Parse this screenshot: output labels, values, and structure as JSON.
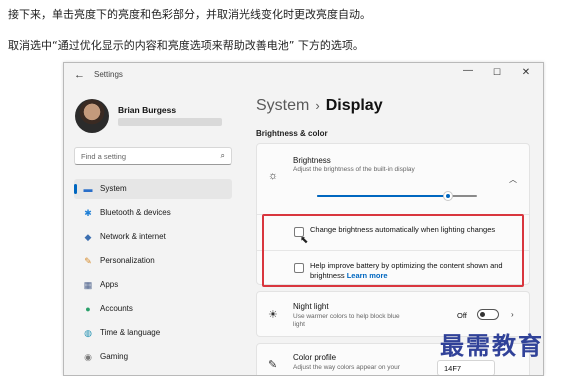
{
  "intro": {
    "line1": "接下来，单击亮度下的亮度和色彩部分，并取消光线变化时更改亮度自动。",
    "line2": "取消选中“通过优化显示的内容和亮度选项来帮助改善电池” 下方的选项。"
  },
  "window": {
    "title": "Settings",
    "controls": {
      "minimize": "—",
      "maximize": "☐",
      "close": "✕"
    }
  },
  "profile": {
    "name": "Brian Burgess"
  },
  "search": {
    "placeholder": "Find a setting"
  },
  "nav": [
    {
      "label": "System",
      "icon": "monitor-icon",
      "active": true
    },
    {
      "label": "Bluetooth & devices",
      "icon": "bluetooth-icon"
    },
    {
      "label": "Network & internet",
      "icon": "wifi-icon"
    },
    {
      "label": "Personalization",
      "icon": "paintbrush-icon"
    },
    {
      "label": "Apps",
      "icon": "apps-icon"
    },
    {
      "label": "Accounts",
      "icon": "person-icon"
    },
    {
      "label": "Time & language",
      "icon": "globe-clock-icon"
    },
    {
      "label": "Gaming",
      "icon": "gamepad-icon"
    }
  ],
  "breadcrumb": {
    "parent": "System",
    "separator": "›",
    "current": "Display"
  },
  "section": {
    "title": "Brightness & color"
  },
  "brightness": {
    "title": "Brightness",
    "subtitle": "Adjust the brightness of the built-in display",
    "level": 0.82,
    "options": [
      {
        "label": "Change brightness automatically when lighting changes",
        "checked": false
      },
      {
        "label": "Help improve battery by optimizing the content shown and brightness",
        "link": "Learn more",
        "checked": false
      }
    ]
  },
  "night_light": {
    "title": "Night light",
    "subtitle": "Use warmer colors to help block blue light",
    "state": "Off"
  },
  "color_profile": {
    "title": "Color profile",
    "subtitle": "Adjust the way colors appear on your",
    "value": "14F7"
  },
  "watermark": "最需教育",
  "colors": {
    "accent": "#0067c0",
    "highlight_box": "#d9363e",
    "watermark": "#1c2f8f"
  }
}
